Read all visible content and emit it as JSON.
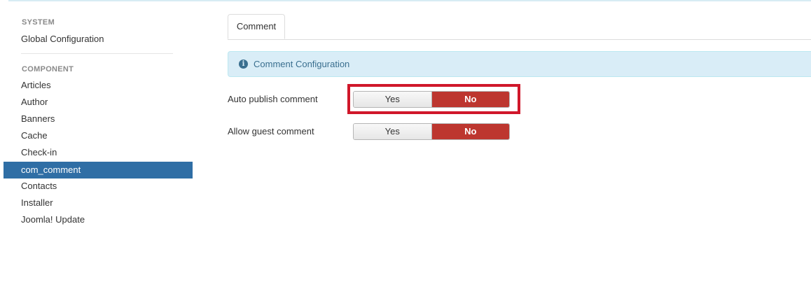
{
  "sidebar": {
    "system_header": "SYSTEM",
    "global_configuration": "Global Configuration",
    "component_header": "COMPONENT",
    "items": [
      {
        "label": "Articles"
      },
      {
        "label": "Author"
      },
      {
        "label": "Banners"
      },
      {
        "label": "Cache"
      },
      {
        "label": "Check-in"
      },
      {
        "label": "com_comment",
        "active": true
      },
      {
        "label": "Contacts"
      },
      {
        "label": "Installer"
      },
      {
        "label": "Joomla! Update"
      }
    ]
  },
  "tabs": [
    {
      "label": "Comment",
      "active": true
    }
  ],
  "alert": {
    "icon": "info-icon",
    "text": "Comment Configuration"
  },
  "fields": [
    {
      "label": "Auto publish comment",
      "yes": "Yes",
      "no": "No",
      "selected": "No",
      "highlighted": true
    },
    {
      "label": "Allow guest comment",
      "yes": "Yes",
      "no": "No",
      "selected": "No"
    }
  ],
  "colors": {
    "active_nav": "#2f6ea5",
    "selected_no": "#bd362f",
    "highlight_box": "#d0172a",
    "alert_bg": "#d9edf7"
  }
}
